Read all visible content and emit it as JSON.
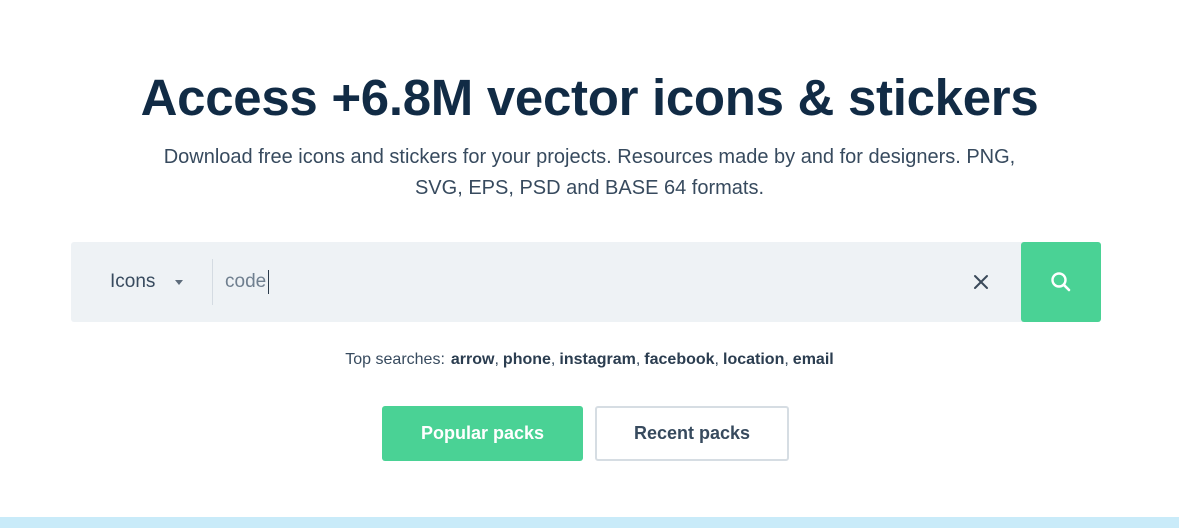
{
  "hero": {
    "title": "Access +6.8M vector icons & stickers",
    "subtitle_line1": "Download free icons and stickers for your projects. Resources made by and for designers. PNG,",
    "subtitle_line2": "SVG, EPS, PSD and BASE 64 formats."
  },
  "search": {
    "type_selected": "Icons",
    "query_value": "code",
    "clear_icon": "close-icon",
    "submit_icon": "search-icon",
    "submit_color": "#4ad295"
  },
  "top_searches": {
    "label": "Top searches:",
    "items": [
      "arrow",
      "phone",
      "instagram",
      "facebook",
      "location",
      "email"
    ]
  },
  "buttons": {
    "popular_label": "Popular packs",
    "recent_label": "Recent packs"
  },
  "colors": {
    "accent": "#4ad295",
    "title": "#112b45",
    "search_bg": "#eef2f5",
    "band": "#c9ebf9"
  }
}
